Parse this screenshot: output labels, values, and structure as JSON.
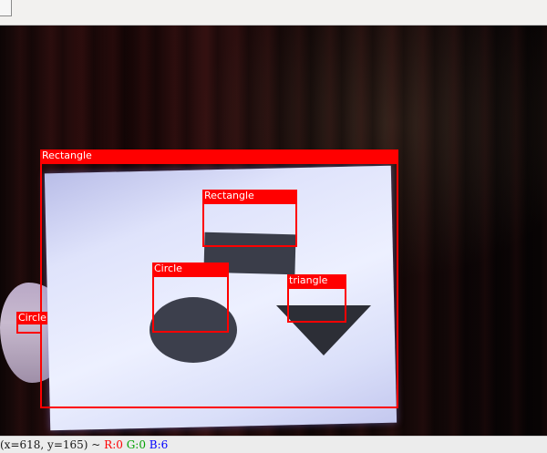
{
  "toolbar": {
    "buttons": []
  },
  "detections": [
    {
      "label": "Rectangle"
    },
    {
      "label": "Rectangle"
    },
    {
      "label": "Circle"
    },
    {
      "label": "triangle"
    },
    {
      "label": "Circle"
    }
  ],
  "status": {
    "coords": "(x=618, y=165) ~",
    "r": "R:0",
    "g": "G:0",
    "b": "B:6"
  },
  "colors": {
    "detection": "#ff0000",
    "r_label": "#ff0000",
    "g_label": "#00a000",
    "b_label": "#0000ff"
  }
}
